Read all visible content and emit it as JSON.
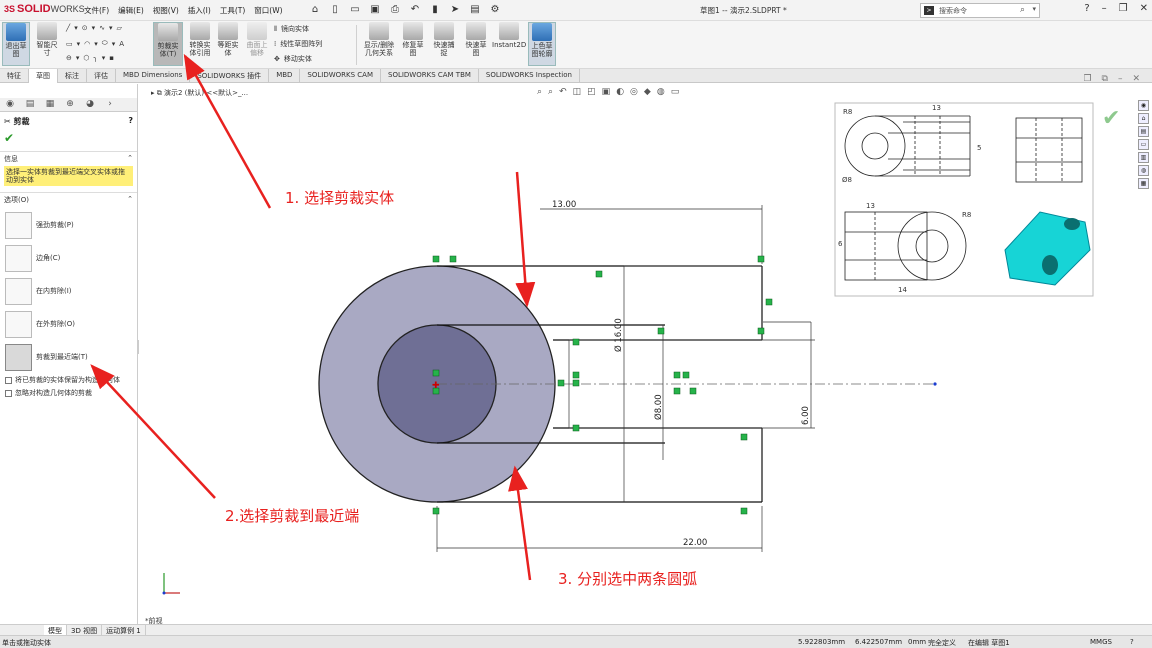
{
  "app": {
    "brand_ds": "3S",
    "brand": "SOLID",
    "brand_suffix": "WORKS"
  },
  "menus": [
    "文件(F)",
    "编辑(E)",
    "视图(V)",
    "插入(I)",
    "工具(T)",
    "窗口(W)"
  ],
  "document_title": "草图1 -- 演示2.SLDPRT *",
  "search": {
    "placeholder": "搜索命令"
  },
  "toolbar": {
    "exit_sketch": "退出草\n图",
    "smart_dim": "智能尺\n寸",
    "trim": "剪裁实\n体(T)",
    "convert": "转换实\n体引用",
    "offset": "等距实\n体",
    "surface_offset": "曲面上\n偏移",
    "mirror": "镜向实体",
    "linear_pattern": "线性草图阵列",
    "move": "移动实体",
    "relations": "显示/删除\n几何关系",
    "repair": "修复草\n图",
    "snap": "快速捕\n捉",
    "rapid": "快速草\n图",
    "instant2d": "Instant2D",
    "shaded": "上色草\n图轮廓"
  },
  "tabs": [
    "特征",
    "草图",
    "标注",
    "评估",
    "MBD Dimensions",
    "SOLIDWORKS 插件",
    "MBD",
    "SOLIDWORKS CAM",
    "SOLIDWORKS CAM TBM",
    "SOLIDWORKS Inspection"
  ],
  "property_manager": {
    "title": "剪裁",
    "help": "?",
    "message_header": "信息",
    "message": "选择一实体剪裁到最近端交叉实体或拖动到实体",
    "options_header": "选项(O)",
    "options": [
      {
        "label": "强劲剪裁(P)"
      },
      {
        "label": "边角(C)"
      },
      {
        "label": "在内剪除(I)"
      },
      {
        "label": "在外剪除(O)"
      },
      {
        "label": "剪裁到最近端(T)"
      }
    ],
    "checkboxes": [
      "将已剪裁的实体保留为构造几何体",
      "忽略对构造几何体的剪裁"
    ]
  },
  "tree_breadcrumb": "演示2 (默认) <<默认>_...",
  "view_name": "*前视",
  "dimensions": {
    "top_width": "13.00",
    "bottom_width": "22.00",
    "outer_dia": "Ø 16.00",
    "inner_dia": "Ø8.00",
    "offset": "6.00"
  },
  "annotations": {
    "step1": "1. 选择剪裁实体",
    "step2": "2.选择剪裁到最近端",
    "step3": "3. 分别选中两条圆弧"
  },
  "reference_drawing": {
    "r8": "R8",
    "r8b": "R8",
    "d": "Ø8",
    "w13a": "13",
    "w13b": "13",
    "w14": "14",
    "h6": "6",
    "h5": "5"
  },
  "bottom_tabs": [
    "模型",
    "3D 视图",
    "运动算例 1"
  ],
  "status": {
    "left": "单击或拖动实体",
    "x": "5.922803mm",
    "y": "6.422507mm",
    "z": "0mm",
    "defined": "完全定义",
    "editing": "在编辑 草图1",
    "units": "MMGS"
  },
  "colors": {
    "annotation_red": "#e8211f",
    "sketch_fill_outer": "#a9a9c3",
    "sketch_fill_inner": "#6f6f95",
    "highlight_yellow": "#ffef78",
    "brand_red": "#c8102e"
  }
}
